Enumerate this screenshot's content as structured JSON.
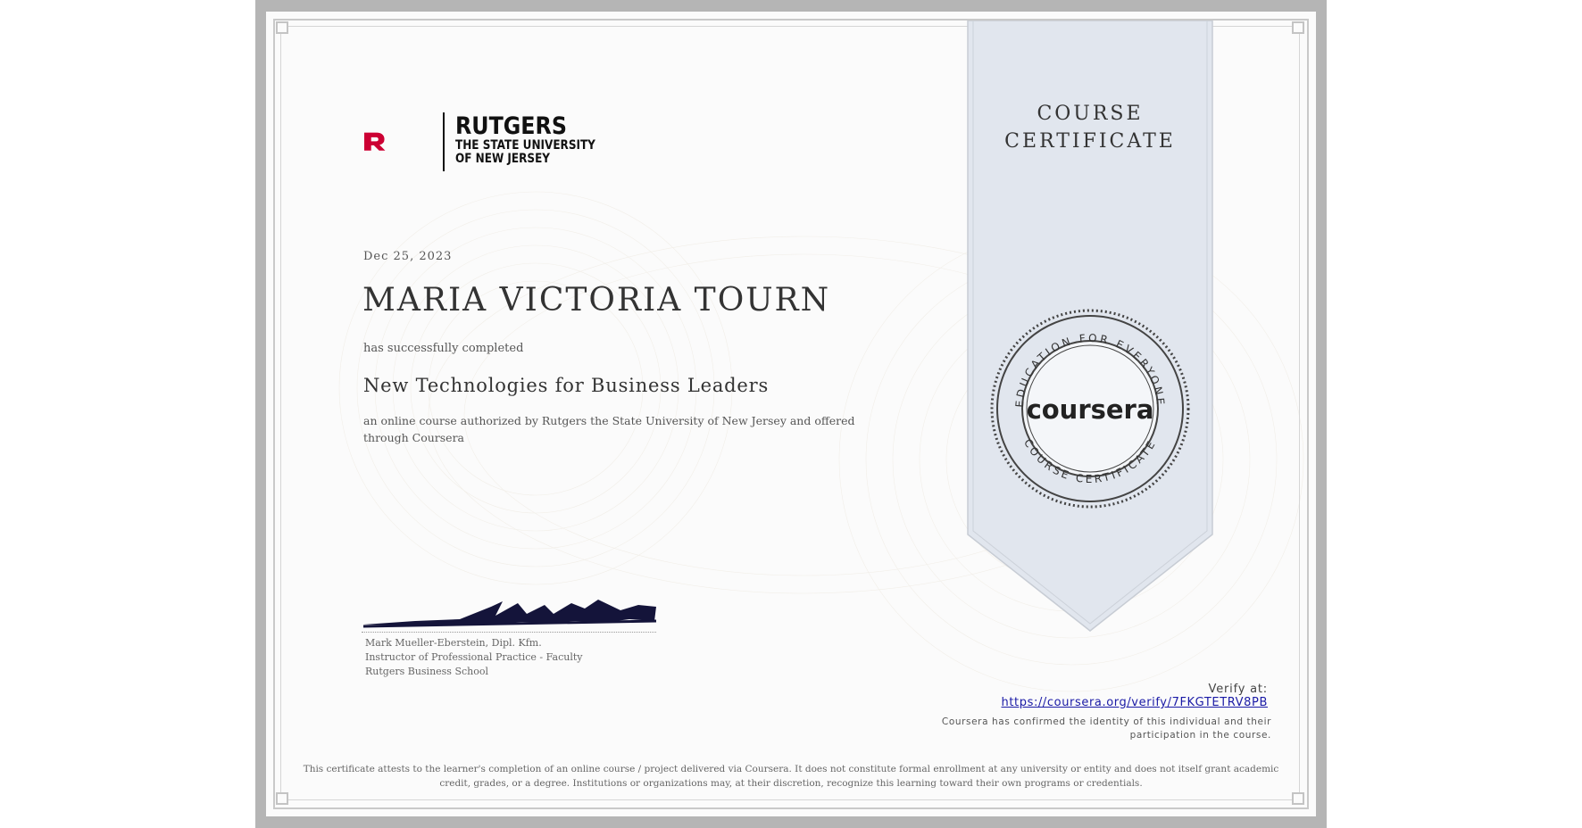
{
  "logo": {
    "brand_color": "#cc0033",
    "lines": [
      "RUTGERS",
      "THE STATE UNIVERSITY",
      "OF NEW JERSEY"
    ]
  },
  "certificate": {
    "date": "Dec 25, 2023",
    "recipient": "MARIA VICTORIA TOURN",
    "completed_text": "has successfully completed",
    "course_title": "New Technologies for Business Leaders",
    "description": "an online course authorized by Rutgers the State University of New Jersey and offered through Coursera"
  },
  "ribbon": {
    "line1": "COURSE",
    "line2": "CERTIFICATE",
    "color": "#e1e6ee"
  },
  "seal": {
    "brand": "coursera",
    "top_text": "EDUCATION FOR EVERYONE",
    "bottom_text": "COURSE CERTIFICATE"
  },
  "signer": {
    "name": "Mark Mueller-Eberstein, Dipl. Kfm.",
    "title": "Instructor of Professional Practice - Faculty",
    "org": "Rutgers Business School"
  },
  "verify": {
    "label": "Verify at:",
    "url": "https://coursera.org/verify/7FKGTETRV8PB",
    "note": "Coursera has confirmed the identity of this individual and their participation in the course."
  },
  "disclaimer": "This certificate attests to the learner's completion of an online course / project delivered via Coursera. It does not constitute formal enrollment at any university or entity and does not itself grant academic credit, grades, or a degree. Institutions or organizations may, at their discretion, recognize this learning toward their own programs or credentials."
}
